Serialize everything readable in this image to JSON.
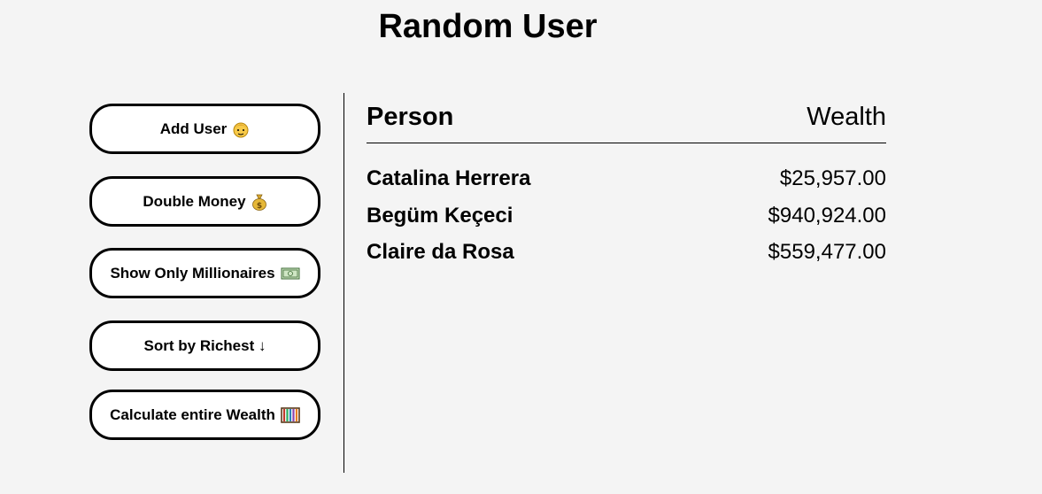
{
  "page": {
    "title": "Random User"
  },
  "sidebar": {
    "buttons": [
      {
        "label": "Add User",
        "icon": "face-icon"
      },
      {
        "label": "Double Money",
        "icon": "money-bag-icon"
      },
      {
        "label": "Show Only Millionaires",
        "icon": "banknote-icon"
      },
      {
        "label": "Sort by Richest ↓",
        "icon": ""
      },
      {
        "label": "Calculate entire Wealth",
        "icon": "abacus-icon"
      }
    ]
  },
  "table": {
    "headers": {
      "person": "Person",
      "wealth": "Wealth"
    },
    "rows": [
      {
        "name": "Catalina Herrera",
        "wealth": "$25,957.00"
      },
      {
        "name": "Begüm Keçeci",
        "wealth": "$940,924.00"
      },
      {
        "name": "Claire da Rosa",
        "wealth": "$559,477.00"
      }
    ]
  },
  "colors": {
    "background": "#f4f4f4",
    "button_background": "#ffffff",
    "border": "#000000"
  }
}
